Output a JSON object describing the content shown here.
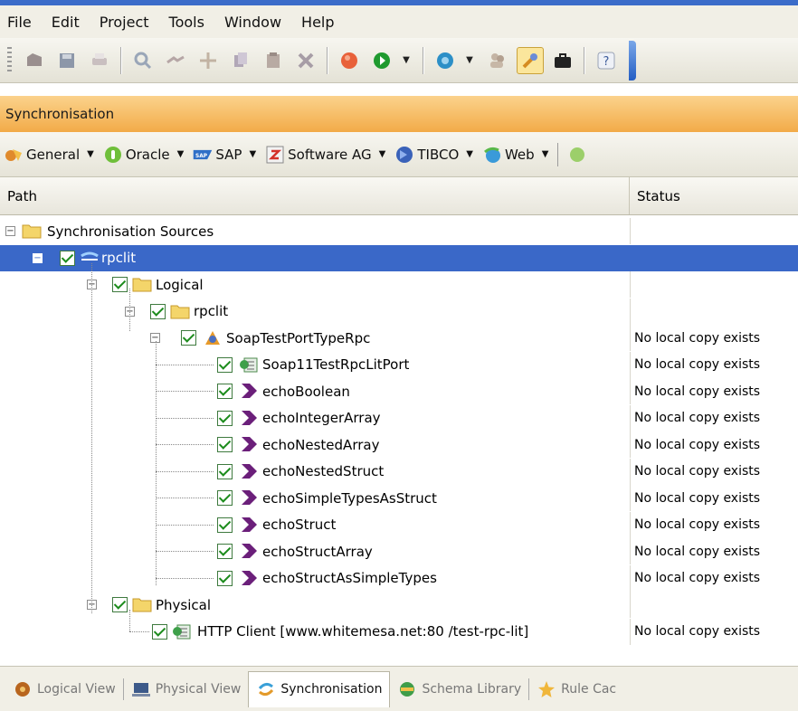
{
  "menu": [
    "File",
    "Edit",
    "Project",
    "Tools",
    "Window",
    "Help"
  ],
  "panel_title": "Synchronisation",
  "sync_toolbar": [
    {
      "label": "General",
      "icon": "general-icon"
    },
    {
      "label": "Oracle",
      "icon": "oracle-icon"
    },
    {
      "label": "SAP",
      "icon": "sap-icon"
    },
    {
      "label": "Software AG",
      "icon": "software-ag-icon"
    },
    {
      "label": "TIBCO",
      "icon": "tibco-icon"
    },
    {
      "label": "Web",
      "icon": "web-icon"
    }
  ],
  "columns": {
    "path": "Path",
    "status": "Status"
  },
  "tree": [
    {
      "label": "Synchronisation Sources",
      "status": ""
    },
    {
      "label": "rpclit",
      "status": ""
    },
    {
      "label": "Logical",
      "status": ""
    },
    {
      "label": "rpclit",
      "status": ""
    },
    {
      "label": "SoapTestPortTypeRpc",
      "status": "No local copy exists"
    },
    {
      "label": "Soap11TestRpcLitPort",
      "status": "No local copy exists"
    },
    {
      "label": "echoBoolean",
      "status": "No local copy exists"
    },
    {
      "label": "echoIntegerArray",
      "status": "No local copy exists"
    },
    {
      "label": "echoNestedArray",
      "status": "No local copy exists"
    },
    {
      "label": "echoNestedStruct",
      "status": "No local copy exists"
    },
    {
      "label": "echoSimpleTypesAsStruct",
      "status": "No local copy exists"
    },
    {
      "label": "echoStruct",
      "status": "No local copy exists"
    },
    {
      "label": "echoStructArray",
      "status": "No local copy exists"
    },
    {
      "label": "echoStructAsSimpleTypes",
      "status": "No local copy exists"
    },
    {
      "label": "Physical",
      "status": ""
    },
    {
      "label": "HTTP Client [www.whitemesa.net:80 /test-rpc-lit]",
      "status": "No local copy exists"
    }
  ],
  "bottom_tabs": [
    {
      "label": "Logical View",
      "icon": "logical-view-icon",
      "active": false
    },
    {
      "label": "Physical View",
      "icon": "physical-view-icon",
      "active": false
    },
    {
      "label": "Synchronisation",
      "icon": "synchronisation-icon",
      "active": true
    },
    {
      "label": "Schema Library",
      "icon": "schema-library-icon",
      "active": false
    },
    {
      "label": "Rule Cac",
      "icon": "rule-cache-icon",
      "active": false
    }
  ]
}
